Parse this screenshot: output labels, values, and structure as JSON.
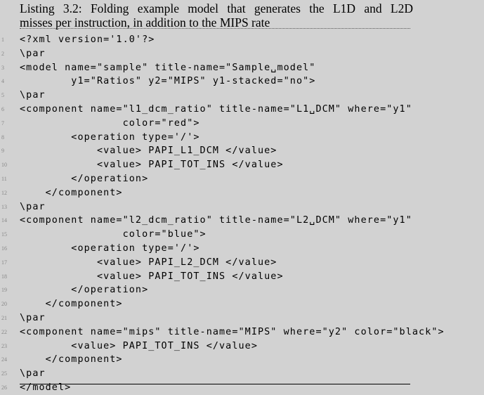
{
  "caption": {
    "line1": "Listing 3.2:  Folding example model that generates the L1D and L2D",
    "line2": "misses per instruction, in addition to the MIPS rate"
  },
  "listing": {
    "lines": [
      {
        "num": "1",
        "text": "<?xml version='1.0'?>"
      },
      {
        "num": "2",
        "text": "\\par"
      },
      {
        "num": "3",
        "text": "<model name=\"sample\" title-name=\"Sample␣model\""
      },
      {
        "num": "4",
        "text": "        y1=\"Ratios\" y2=\"MIPS\" y1-stacked=\"no\">"
      },
      {
        "num": "5",
        "text": "\\par"
      },
      {
        "num": "6",
        "text": "<component name=\"l1_dcm_ratio\" title-name=\"L1␣DCM\" where=\"y1\""
      },
      {
        "num": "7",
        "text": "                color=\"red\">"
      },
      {
        "num": "8",
        "text": "        <operation type='/'>"
      },
      {
        "num": "9",
        "text": "            <value> PAPI_L1_DCM </value>"
      },
      {
        "num": "10",
        "text": "            <value> PAPI_TOT_INS </value>"
      },
      {
        "num": "11",
        "text": "        </operation>"
      },
      {
        "num": "12",
        "text": "    </component>"
      },
      {
        "num": "13",
        "text": "\\par"
      },
      {
        "num": "14",
        "text": "<component name=\"l2_dcm_ratio\" title-name=\"L2␣DCM\" where=\"y1\""
      },
      {
        "num": "15",
        "text": "                color=\"blue\">"
      },
      {
        "num": "16",
        "text": "        <operation type='/'>"
      },
      {
        "num": "17",
        "text": "            <value> PAPI_L2_DCM </value>"
      },
      {
        "num": "18",
        "text": "            <value> PAPI_TOT_INS </value>"
      },
      {
        "num": "19",
        "text": "        </operation>"
      },
      {
        "num": "20",
        "text": "    </component>"
      },
      {
        "num": "21",
        "text": "\\par"
      },
      {
        "num": "22",
        "text": "<component name=\"mips\" title-name=\"MIPS\" where=\"y2\" color=\"black\">"
      },
      {
        "num": "23",
        "text": "        <value> PAPI_TOT_INS </value>"
      },
      {
        "num": "24",
        "text": "    </component>"
      },
      {
        "num": "25",
        "text": "\\par"
      },
      {
        "num": "26",
        "text": "</model>"
      }
    ]
  }
}
